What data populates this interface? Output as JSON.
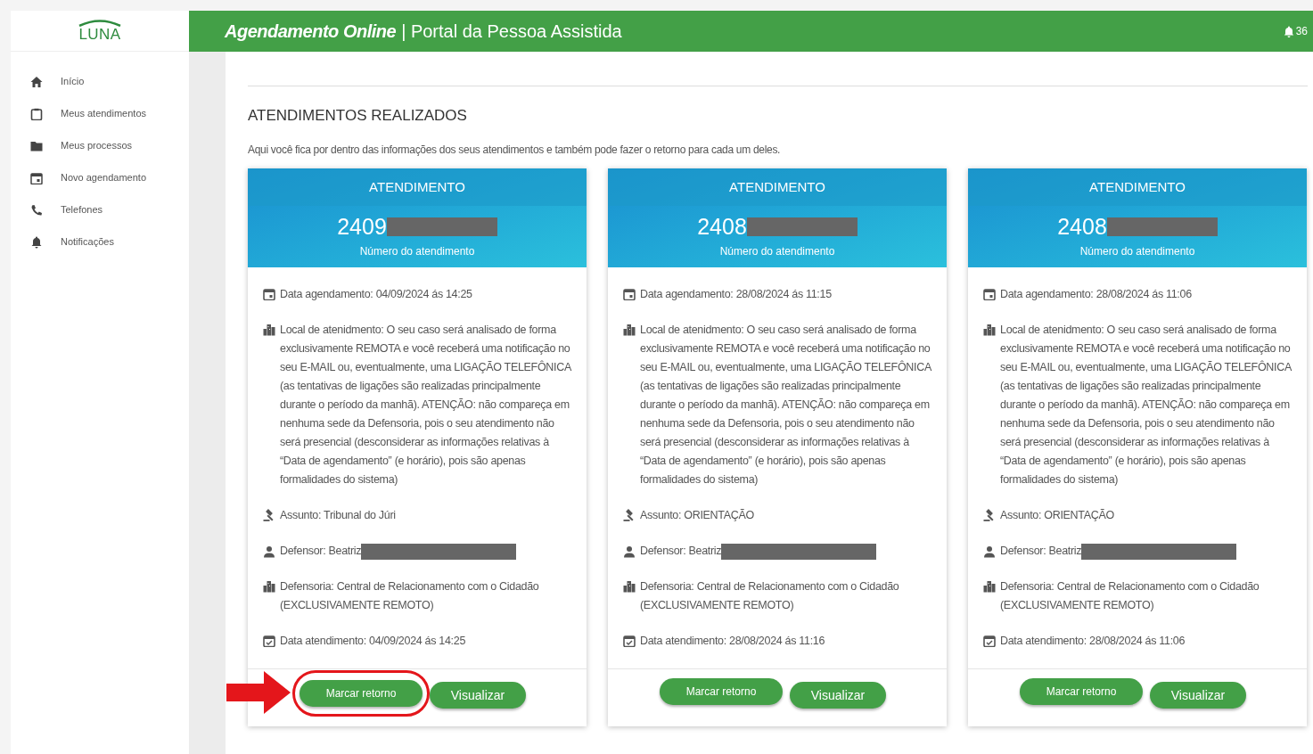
{
  "sidebar": {
    "logo": "LUNA",
    "items": [
      {
        "label": "Início"
      },
      {
        "label": "Meus atendimentos"
      },
      {
        "label": "Meus processos"
      },
      {
        "label": "Novo agendamento"
      },
      {
        "label": "Telefones"
      },
      {
        "label": "Notificações"
      }
    ]
  },
  "header": {
    "title": "Agendamento Online",
    "subtitle": "| Portal da Pessoa Assistida",
    "notification_count": "36"
  },
  "section": {
    "title": "ATENDIMENTOS REALIZADOS",
    "description": "Aqui você fica por dentro das informações dos seus atendimentos e também pode fazer o retorno para cada um deles."
  },
  "cards": [
    {
      "heading": "ATENDIMENTO",
      "number": "2409",
      "number_label": "Número do atendimento",
      "highlighted": true,
      "fields": [
        {
          "kind": "scheduled",
          "text": "Data agendamento: 04/09/2024 ás 14:25"
        },
        {
          "kind": "place",
          "text": "Local de atenidmento: O seu caso será analisado de forma exclusivamente REMOTA e você receberá uma notificação no seu E-MAIL ou, eventualmente, uma LIGAÇÃO TELEFÔNICA (as tentativas de ligações são realizadas principalmente durante o período da manhã). ATENÇÃO: não compareça em nenhuma sede da Defensoria, pois o seu atendimento não será presencial (desconsiderar as informações relativas à “Data de agendamento” (e horário), pois são apenas formalidades do sistema)"
        },
        {
          "kind": "subject",
          "text": "Assunto: Tribunal do Júri"
        },
        {
          "kind": "person",
          "text": "Defensor: Beatriz"
        },
        {
          "kind": "office",
          "text": "Defensoria: Central de Relacionamento com o Cidadão (EXCLUSIVAMENTE REMOTO)"
        },
        {
          "kind": "done",
          "text": "Data atendimento: 04/09/2024 ás 14:25"
        }
      ],
      "buttons": [
        "Marcar retorno",
        "Visualizar"
      ]
    },
    {
      "heading": "ATENDIMENTO",
      "number": "2408",
      "number_label": "Número do atendimento",
      "highlighted": false,
      "fields": [
        {
          "kind": "scheduled",
          "text": "Data agendamento: 28/08/2024 ás 11:15"
        },
        {
          "kind": "place",
          "text": "Local de atenidmento: O seu caso será analisado de forma exclusivamente REMOTA e você receberá uma notificação no seu E-MAIL ou, eventualmente, uma LIGAÇÃO TELEFÔNICA (as tentativas de ligações são realizadas principalmente durante o período da manhã). ATENÇÃO: não compareça em nenhuma sede da Defensoria, pois o seu atendimento não será presencial (desconsiderar as informações relativas à “Data de agendamento” (e horário), pois são apenas formalidades do sistema)"
        },
        {
          "kind": "subject",
          "text": "Assunto: ORIENTAÇÃO"
        },
        {
          "kind": "person",
          "text": "Defensor: Beatriz"
        },
        {
          "kind": "office",
          "text": "Defensoria: Central de Relacionamento com o Cidadão (EXCLUSIVAMENTE REMOTO)"
        },
        {
          "kind": "done",
          "text": "Data atendimento: 28/08/2024 ás 11:16"
        }
      ],
      "buttons": [
        "Marcar retorno",
        "Visualizar"
      ]
    },
    {
      "heading": "ATENDIMENTO",
      "number": "2408",
      "number_label": "Número do atendimento",
      "highlighted": false,
      "fields": [
        {
          "kind": "scheduled",
          "text": "Data agendamento: 28/08/2024 ás 11:06"
        },
        {
          "kind": "place",
          "text": "Local de atenidmento: O seu caso será analisado de forma exclusivamente REMOTA e você receberá uma notificação no seu E-MAIL ou, eventualmente, uma LIGAÇÃO TELEFÔNICA (as tentativas de ligações são realizadas principalmente durante o período da manhã). ATENÇÃO: não compareça em nenhuma sede da Defensoria, pois o seu atendimento não será presencial (desconsiderar as informações relativas à “Data de agendamento” (e horário), pois são apenas formalidades do sistema)"
        },
        {
          "kind": "subject",
          "text": "Assunto: ORIENTAÇÃO"
        },
        {
          "kind": "person",
          "text": "Defensor: Beatriz"
        },
        {
          "kind": "office",
          "text": "Defensoria: Central de Relacionamento com o Cidadão (EXCLUSIVAMENTE REMOTO)"
        },
        {
          "kind": "done",
          "text": "Data atendimento: 28/08/2024 ás 11:06"
        }
      ],
      "buttons": [
        "Marcar retorno",
        "Visualizar"
      ]
    }
  ]
}
